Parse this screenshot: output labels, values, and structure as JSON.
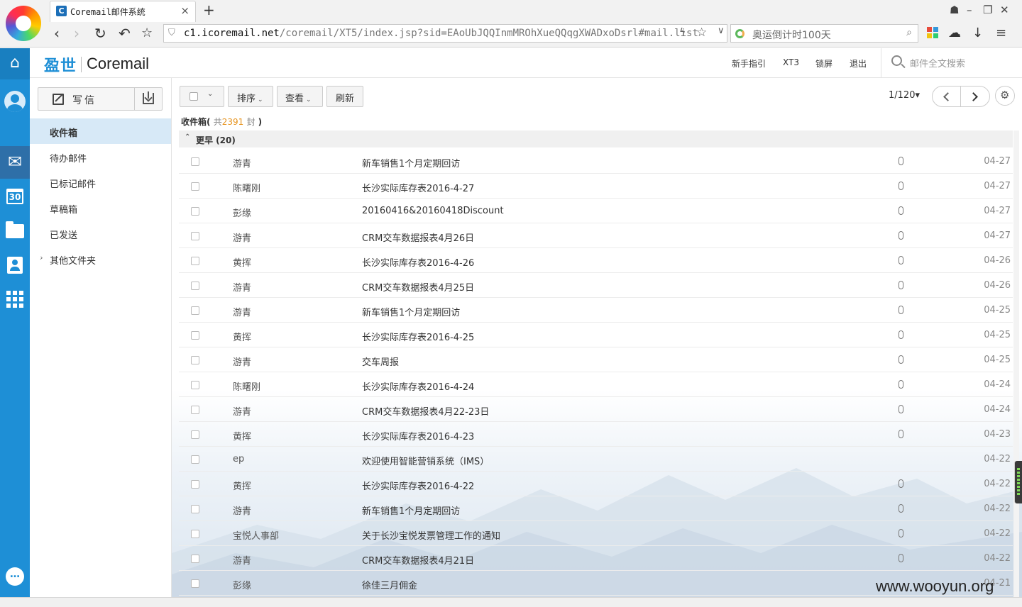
{
  "browser": {
    "tab_title": "Coremail邮件系统",
    "url_host": "c1.icoremail.net",
    "url_path": "/coremail/XT5/index.jsp?sid=EAoUbJQQInmMROhXueQQqgXWADxoDsrl#mail.list",
    "search_text": "奥运倒计时100天"
  },
  "header": {
    "brand_cn": "盈世",
    "brand_en": "Coremail",
    "links": [
      "新手指引",
      "XT3",
      "锁屏",
      "退出"
    ],
    "search_placeholder": "邮件全文搜索"
  },
  "sidebar": {
    "compose_label": "写信",
    "folders": [
      {
        "label": "收件箱",
        "active": true
      },
      {
        "label": "待办邮件"
      },
      {
        "label": "已标记邮件"
      },
      {
        "label": "草稿箱"
      },
      {
        "label": "已发送"
      },
      {
        "label": "其他文件夹"
      }
    ]
  },
  "toolbar": {
    "sort_label": "排序",
    "view_label": "查看",
    "refresh_label": "刷新",
    "page_indicator": "1/120▾"
  },
  "list": {
    "folder_name": "收件箱(",
    "count_prefix": "共",
    "count_value": "2391",
    "count_suffix": "封",
    "close_paren": ")",
    "group_label": "更早 (20)",
    "rows": [
      {
        "sender": "游青",
        "subject": "新车销售1个月定期回访",
        "date": "04-27",
        "attachment": true
      },
      {
        "sender": "陈曙刚",
        "subject": "长沙实际库存表2016-4-27",
        "date": "04-27",
        "attachment": true
      },
      {
        "sender": "彭缘",
        "subject": "20160416&20160418Discount",
        "date": "04-27",
        "attachment": true
      },
      {
        "sender": "游青",
        "subject": "CRM交车数据报表4月26日",
        "date": "04-27",
        "attachment": true
      },
      {
        "sender": "黄挥",
        "subject": "长沙实际库存表2016-4-26",
        "date": "04-26",
        "attachment": true
      },
      {
        "sender": "游青",
        "subject": "CRM交车数据报表4月25日",
        "date": "04-26",
        "attachment": true
      },
      {
        "sender": "游青",
        "subject": "新车销售1个月定期回访",
        "date": "04-25",
        "attachment": true
      },
      {
        "sender": "黄挥",
        "subject": "长沙实际库存表2016-4-25",
        "date": "04-25",
        "attachment": true
      },
      {
        "sender": "游青",
        "subject": "交车周报",
        "date": "04-25",
        "attachment": true
      },
      {
        "sender": "陈曙刚",
        "subject": "长沙实际库存表2016-4-24",
        "date": "04-24",
        "attachment": true
      },
      {
        "sender": "游青",
        "subject": "CRM交车数据报表4月22-23日",
        "date": "04-24",
        "attachment": true
      },
      {
        "sender": "黄挥",
        "subject": "长沙实际库存表2016-4-23",
        "date": "04-23",
        "attachment": true
      },
      {
        "sender": "ep",
        "subject": "欢迎使用智能营销系统（IMS）",
        "date": "04-22",
        "attachment": false
      },
      {
        "sender": "黄挥",
        "subject": "长沙实际库存表2016-4-22",
        "date": "04-22",
        "attachment": true
      },
      {
        "sender": "游青",
        "subject": "新车销售1个月定期回访",
        "date": "04-22",
        "attachment": true
      },
      {
        "sender": "宝悦人事部",
        "subject": "关于长沙宝悦发票管理工作的通知",
        "date": "04-22",
        "attachment": true
      },
      {
        "sender": "游青",
        "subject": "CRM交车数据报表4月21日",
        "date": "04-22",
        "attachment": true
      },
      {
        "sender": "彭缘",
        "subject": "徐佳三月佣金",
        "date": "04-21",
        "attachment": false
      }
    ]
  },
  "watermark": "www.wooyun.org",
  "colors": {
    "brand_blue": "#1e8fd6",
    "active_folder_bg": "#d7e9f7",
    "count_orange": "#e6931e"
  }
}
